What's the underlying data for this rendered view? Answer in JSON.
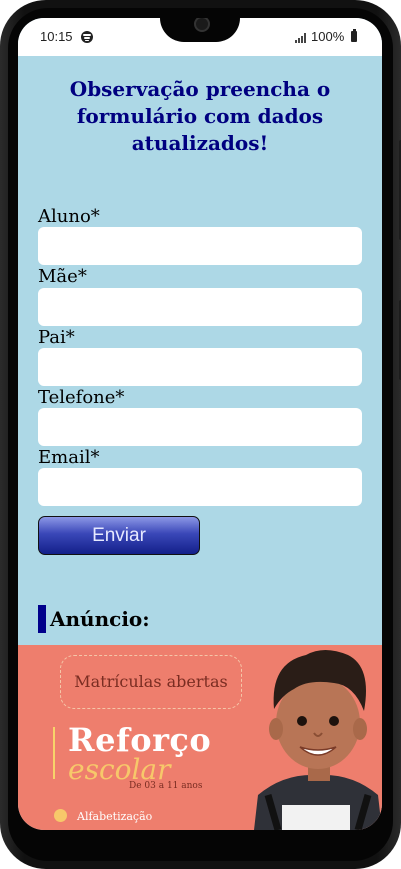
{
  "status_bar": {
    "time": "10:15",
    "battery": "100%"
  },
  "form": {
    "note": "Observação preencha o formulário com dados atualizados!",
    "fields": [
      {
        "label": "Aluno*",
        "value": ""
      },
      {
        "label": "Mãe*",
        "value": ""
      },
      {
        "label": "Pai*",
        "value": ""
      },
      {
        "label": "Telefone*",
        "value": ""
      },
      {
        "label": "Email*",
        "value": ""
      }
    ],
    "submit_label": "Enviar"
  },
  "ad": {
    "heading": "Anúncio:",
    "banner": {
      "pill_text": "Matrículas abertas",
      "title_line1": "Reforço",
      "title_line2": "escolar",
      "age_range": "De 03 a 11 anos",
      "item": "Alfabetização"
    }
  },
  "colors": {
    "page_background": "#add8e6",
    "title": "#000080",
    "banner": "#ee7e6d",
    "accent_yellow": "#f7c86a",
    "button_gradient_end": "#13208a"
  },
  "icons": [
    "spotify-icon",
    "signal-icon",
    "battery-icon",
    "camera-notch"
  ]
}
